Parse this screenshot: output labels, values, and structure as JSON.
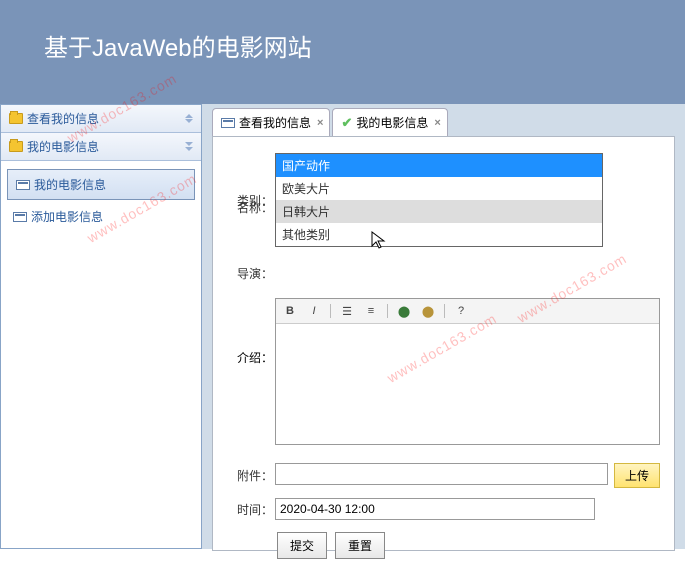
{
  "header": {
    "title": "基于JavaWeb的电影网站"
  },
  "sidebar": {
    "groups": [
      {
        "label": "查看我的信息"
      },
      {
        "label": "我的电影信息"
      }
    ],
    "items": [
      {
        "label": "我的电影信息"
      },
      {
        "label": "添加电影信息"
      }
    ]
  },
  "tabs": [
    {
      "label": "查看我的信息"
    },
    {
      "label": "我的电影信息"
    }
  ],
  "form": {
    "category_label": "类别：",
    "name_label": "名称：",
    "director_label": "导演：",
    "intro_label": "介绍：",
    "attachment_label": "附件：",
    "time_label": "时间：",
    "upload_label": "上传",
    "submit_label": "提交",
    "reset_label": "重置",
    "time_value": "2020-04-30 12:00",
    "category_options": [
      "国产动作",
      "欧美大片",
      "日韩大片",
      "其他类别"
    ]
  },
  "watermark": "www.doc163.com"
}
